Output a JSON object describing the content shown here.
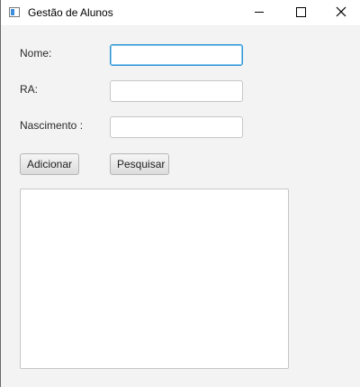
{
  "window": {
    "title": "Gestão de Alunos"
  },
  "form": {
    "nome_label": "Nome:",
    "ra_label": "RA:",
    "nascimento_label": "Nascimento :",
    "nome_value": "",
    "ra_value": "",
    "nascimento_value": ""
  },
  "buttons": {
    "adicionar_label": "Adicionar",
    "pesquisar_label": "Pesquisar"
  },
  "output": {
    "text": ""
  },
  "icons": {
    "app": "app-window-icon",
    "minimize": "minimize-icon",
    "maximize": "maximize-icon",
    "close": "close-icon"
  },
  "colors": {
    "focus_border": "#2a93d5",
    "background": "#f3f3f3"
  }
}
